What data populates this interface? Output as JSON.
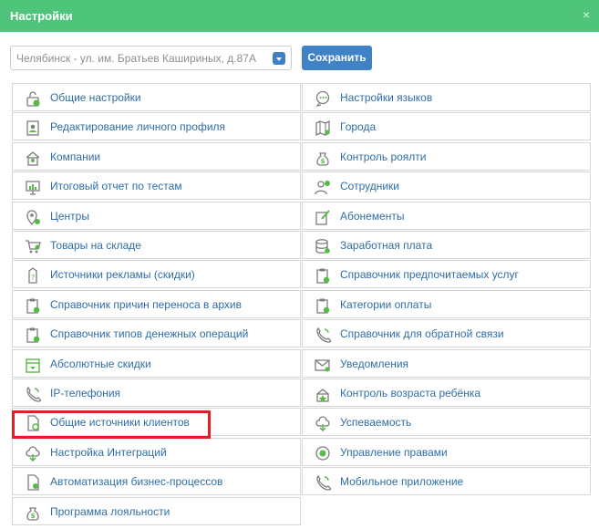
{
  "header": {
    "title": "Настройки",
    "close": "×"
  },
  "branch_select": {
    "value": "Челябинск - ул. им. Братьев Кашириных, д.87А"
  },
  "save_button": {
    "label": "Сохранить"
  },
  "colors": {
    "header": "#4fc47b",
    "link": "#2f6ea8",
    "button": "#3f82c6",
    "highlight": "#e01f26"
  },
  "left_items": [
    {
      "label": "Общие настройки",
      "icon": "lock-icon"
    },
    {
      "label": "Редактирование личного профиля",
      "icon": "profile-icon"
    },
    {
      "label": "Компании",
      "icon": "house-icon"
    },
    {
      "label": "Итоговый отчет по тестам",
      "icon": "chart-icon"
    },
    {
      "label": "Центры",
      "icon": "map-pin-icon"
    },
    {
      "label": "Товары на складе",
      "icon": "cart-icon"
    },
    {
      "label": "Источники рекламы (скидки)",
      "icon": "tag-icon"
    },
    {
      "label": "Справочник причин переноса в архив",
      "icon": "clipboard-icon"
    },
    {
      "label": "Справочник типов денежных операций",
      "icon": "clipboard-icon"
    },
    {
      "label": "Абсолютные скидки",
      "icon": "calendar-icon"
    },
    {
      "label": "IP-телефония",
      "icon": "phone-icon"
    },
    {
      "label": "Общие источники клиентов",
      "icon": "document-refresh-icon"
    },
    {
      "label": "Настройка Интеграций",
      "icon": "cloud-icon"
    },
    {
      "label": "Автоматизация бизнес-процессов",
      "icon": "document-gear-icon"
    },
    {
      "label": "Программа лояльности",
      "icon": "money-bag-icon"
    }
  ],
  "right_items": [
    {
      "label": "Настройки языков",
      "icon": "chat-icon"
    },
    {
      "label": "Города",
      "icon": "map-icon"
    },
    {
      "label": "Контроль роялти",
      "icon": "money-bag-icon"
    },
    {
      "label": "Сотрудники",
      "icon": "users-icon"
    },
    {
      "label": "Абонементы",
      "icon": "edit-icon"
    },
    {
      "label": "Заработная плата",
      "icon": "database-icon"
    },
    {
      "label": "Справочник предпочитаемых услуг",
      "icon": "clipboard-icon"
    },
    {
      "label": "Категории оплаты",
      "icon": "clipboard-icon"
    },
    {
      "label": "Справочник для обратной связи",
      "icon": "phone-icon"
    },
    {
      "label": "Уведомления",
      "icon": "envelope-icon"
    },
    {
      "label": "Контроль возраста ребёнка",
      "icon": "cake-icon"
    },
    {
      "label": "Успеваемость",
      "icon": "cloud-icon"
    },
    {
      "label": "Управление правами",
      "icon": "target-icon"
    },
    {
      "label": "Мобильное приложение",
      "icon": "phone-icon"
    }
  ]
}
